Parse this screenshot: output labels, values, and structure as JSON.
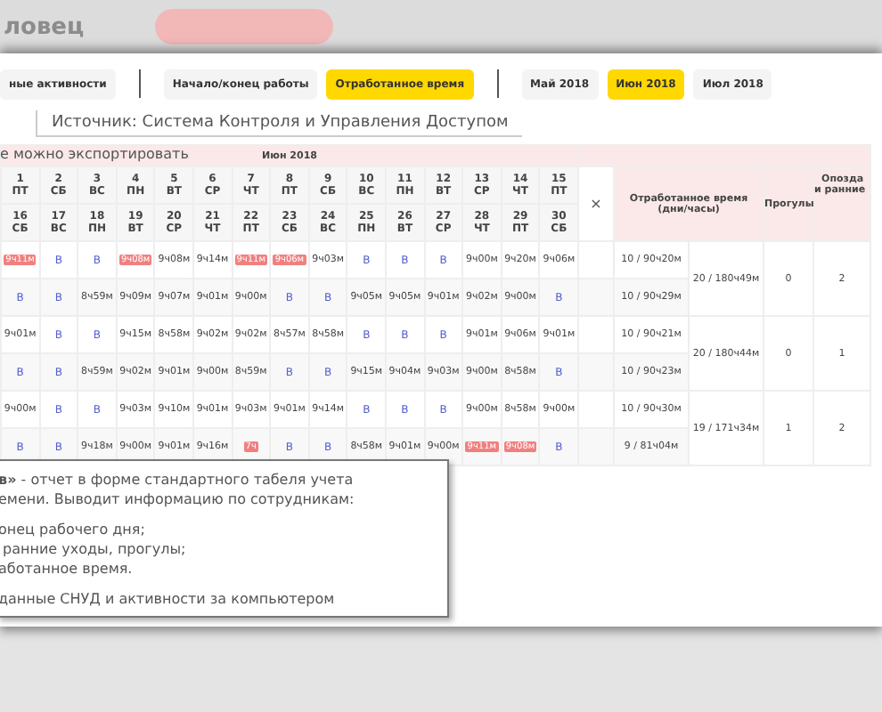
{
  "header": {
    "title": "ловец"
  },
  "report_tabs": [
    {
      "label": "ные активности",
      "selected": false
    },
    {
      "label": "Начало/конец работы",
      "selected": false
    },
    {
      "label": "Отработанное время",
      "selected": true
    }
  ],
  "month_tabs": [
    {
      "label": "Май 2018",
      "selected": false
    },
    {
      "label": "Июн 2018",
      "selected": true
    },
    {
      "label": "Июл 2018",
      "selected": false
    }
  ],
  "source_tab": {
    "label": "Источник: Система Контроля и Управления Доступом"
  },
  "export_note": "е можно экспортировать",
  "table": {
    "month": "Июн 2018",
    "close_label": "×",
    "days_top": [
      {
        "num": "1",
        "weekday": "ПТ"
      },
      {
        "num": "2",
        "weekday": "СБ"
      },
      {
        "num": "3",
        "weekday": "ВС"
      },
      {
        "num": "4",
        "weekday": "ПН"
      },
      {
        "num": "5",
        "weekday": "ВТ"
      },
      {
        "num": "6",
        "weekday": "СР"
      },
      {
        "num": "7",
        "weekday": "ЧТ"
      },
      {
        "num": "8",
        "weekday": "ПТ"
      },
      {
        "num": "9",
        "weekday": "СБ"
      },
      {
        "num": "10",
        "weekday": "ВС"
      },
      {
        "num": "11",
        "weekday": "ПН"
      },
      {
        "num": "12",
        "weekday": "ВТ"
      },
      {
        "num": "13",
        "weekday": "СР"
      },
      {
        "num": "14",
        "weekday": "ЧТ"
      },
      {
        "num": "15",
        "weekday": "ПТ"
      }
    ],
    "days_bottom": [
      {
        "num": "16",
        "weekday": "СБ"
      },
      {
        "num": "17",
        "weekday": "ВС"
      },
      {
        "num": "18",
        "weekday": "ПН"
      },
      {
        "num": "19",
        "weekday": "ВТ"
      },
      {
        "num": "20",
        "weekday": "СР"
      },
      {
        "num": "21",
        "weekday": "ЧТ"
      },
      {
        "num": "22",
        "weekday": "ПТ"
      },
      {
        "num": "23",
        "weekday": "СБ"
      },
      {
        "num": "24",
        "weekday": "ВС"
      },
      {
        "num": "25",
        "weekday": "ПН"
      },
      {
        "num": "26",
        "weekday": "ВТ"
      },
      {
        "num": "27",
        "weekday": "СР"
      },
      {
        "num": "28",
        "weekday": "ЧТ"
      },
      {
        "num": "29",
        "weekday": "ПТ"
      },
      {
        "num": "30",
        "weekday": "СБ"
      }
    ],
    "headings": {
      "worked": "Отработанное время (дни/часы)",
      "absences": "Прогулы",
      "late_line_1": "Опозда",
      "late_line_2": "и ранние"
    },
    "employees": [
      {
        "rows": [
          {
            "cells": [
              {
                "kind": "late",
                "text": "9ч11м"
              },
              {
                "kind": "off",
                "text": "В"
              },
              {
                "kind": "off",
                "text": "В"
              },
              {
                "kind": "late",
                "text": "9ч08м"
              },
              {
                "kind": "time",
                "text": "9ч08м"
              },
              {
                "kind": "time",
                "text": "9ч14м"
              },
              {
                "kind": "late",
                "text": "9ч11м"
              },
              {
                "kind": "late",
                "text": "9ч06м"
              },
              {
                "kind": "time",
                "text": "9ч03м"
              },
              {
                "kind": "off",
                "text": "В"
              },
              {
                "kind": "off",
                "text": "В"
              },
              {
                "kind": "off",
                "text": "В"
              },
              {
                "kind": "time",
                "text": "9ч00м"
              },
              {
                "kind": "time",
                "text": "9ч20м"
              },
              {
                "kind": "time",
                "text": "9ч06м"
              }
            ],
            "worked": "10 / 90ч20м"
          },
          {
            "cells": [
              {
                "kind": "off",
                "text": "В"
              },
              {
                "kind": "off",
                "text": "В"
              },
              {
                "kind": "time",
                "text": "8ч59м"
              },
              {
                "kind": "time",
                "text": "9ч09м"
              },
              {
                "kind": "time",
                "text": "9ч07м"
              },
              {
                "kind": "time",
                "text": "9ч01м"
              },
              {
                "kind": "time",
                "text": "9ч00м"
              },
              {
                "kind": "off",
                "text": "В"
              },
              {
                "kind": "off",
                "text": "В"
              },
              {
                "kind": "time",
                "text": "9ч05м"
              },
              {
                "kind": "time",
                "text": "9ч05м"
              },
              {
                "kind": "time",
                "text": "9ч01м"
              },
              {
                "kind": "time",
                "text": "9ч02м"
              },
              {
                "kind": "time",
                "text": "9ч00м"
              },
              {
                "kind": "off",
                "text": "В"
              }
            ],
            "worked": "10 / 90ч29м"
          }
        ],
        "total": "20 / 180ч49м",
        "absences": "0",
        "late": "2"
      },
      {
        "rows": [
          {
            "cells": [
              {
                "kind": "time",
                "text": "9ч01м"
              },
              {
                "kind": "off",
                "text": "В"
              },
              {
                "kind": "off",
                "text": "В"
              },
              {
                "kind": "time",
                "text": "9ч15м"
              },
              {
                "kind": "time",
                "text": "8ч58м"
              },
              {
                "kind": "time",
                "text": "9ч02м"
              },
              {
                "kind": "time",
                "text": "9ч02м"
              },
              {
                "kind": "time",
                "text": "8ч57м"
              },
              {
                "kind": "time",
                "text": "8ч58м"
              },
              {
                "kind": "off",
                "text": "В"
              },
              {
                "kind": "off",
                "text": "В"
              },
              {
                "kind": "off",
                "text": "В"
              },
              {
                "kind": "time",
                "text": "9ч01м"
              },
              {
                "kind": "time",
                "text": "9ч06м"
              },
              {
                "kind": "time",
                "text": "9ч01м"
              }
            ],
            "worked": "10 / 90ч21м"
          },
          {
            "cells": [
              {
                "kind": "off",
                "text": "В"
              },
              {
                "kind": "off",
                "text": "В"
              },
              {
                "kind": "time",
                "text": "8ч59м"
              },
              {
                "kind": "time",
                "text": "9ч02м"
              },
              {
                "kind": "time",
                "text": "9ч01м"
              },
              {
                "kind": "time",
                "text": "9ч00м"
              },
              {
                "kind": "time",
                "text": "8ч59м"
              },
              {
                "kind": "off",
                "text": "В"
              },
              {
                "kind": "off",
                "text": "В"
              },
              {
                "kind": "time",
                "text": "9ч15м"
              },
              {
                "kind": "time",
                "text": "9ч04м"
              },
              {
                "kind": "time",
                "text": "9ч03м"
              },
              {
                "kind": "time",
                "text": "9ч00м"
              },
              {
                "kind": "time",
                "text": "8ч58м"
              },
              {
                "kind": "off",
                "text": "В"
              }
            ],
            "worked": "10 / 90ч23м"
          }
        ],
        "total": "20 / 180ч44м",
        "absences": "0",
        "late": "1"
      },
      {
        "rows": [
          {
            "cells": [
              {
                "kind": "time",
                "text": "9ч00м"
              },
              {
                "kind": "off",
                "text": "В"
              },
              {
                "kind": "off",
                "text": "В"
              },
              {
                "kind": "time",
                "text": "9ч03м"
              },
              {
                "kind": "time",
                "text": "9ч10м"
              },
              {
                "kind": "time",
                "text": "9ч01м"
              },
              {
                "kind": "time",
                "text": "9ч03м"
              },
              {
                "kind": "time",
                "text": "9ч01м"
              },
              {
                "kind": "time",
                "text": "9ч14м"
              },
              {
                "kind": "off",
                "text": "В"
              },
              {
                "kind": "off",
                "text": "В"
              },
              {
                "kind": "off",
                "text": "В"
              },
              {
                "kind": "time",
                "text": "9ч00м"
              },
              {
                "kind": "time",
                "text": "8ч58м"
              },
              {
                "kind": "time",
                "text": "9ч00м"
              }
            ],
            "worked": "10 / 90ч30м"
          },
          {
            "cells": [
              {
                "kind": "off",
                "text": "В"
              },
              {
                "kind": "off",
                "text": "В"
              },
              {
                "kind": "time",
                "text": "9ч18м"
              },
              {
                "kind": "time",
                "text": "9ч00м"
              },
              {
                "kind": "time",
                "text": "9ч01м"
              },
              {
                "kind": "time",
                "text": "9ч16м"
              },
              {
                "kind": "late",
                "text": "7ч"
              },
              {
                "kind": "off",
                "text": "В"
              },
              {
                "kind": "off",
                "text": "В"
              },
              {
                "kind": "time",
                "text": "8ч58м"
              },
              {
                "kind": "time",
                "text": "9ч01м"
              },
              {
                "kind": "time",
                "text": "9ч00м"
              },
              {
                "kind": "late",
                "text": "9ч11м"
              },
              {
                "kind": "late",
                "text": "9ч08м"
              },
              {
                "kind": "off",
                "text": "В"
              }
            ],
            "worked": "9 / 81ч04м"
          }
        ],
        "total": "19 / 171ч34м",
        "absences": "1",
        "late": "2"
      }
    ]
  },
  "callout": {
    "lines": [
      {
        "kind": "lead",
        "text": "**в»** - отчет в форме стандартного табеля учета"
      },
      {
        "kind": "lead",
        "text": "емени. Выводит информацию по сотрудникам:"
      },
      {
        "kind": "item",
        "text": "онец рабочего дня;"
      },
      {
        "kind": "item",
        "text": " ранние уходы, прогулы;"
      },
      {
        "kind": "item",
        "text": "аботанное время."
      },
      {
        "kind": "note",
        "text": "данные СНУД и активности за компьютером"
      }
    ]
  }
}
